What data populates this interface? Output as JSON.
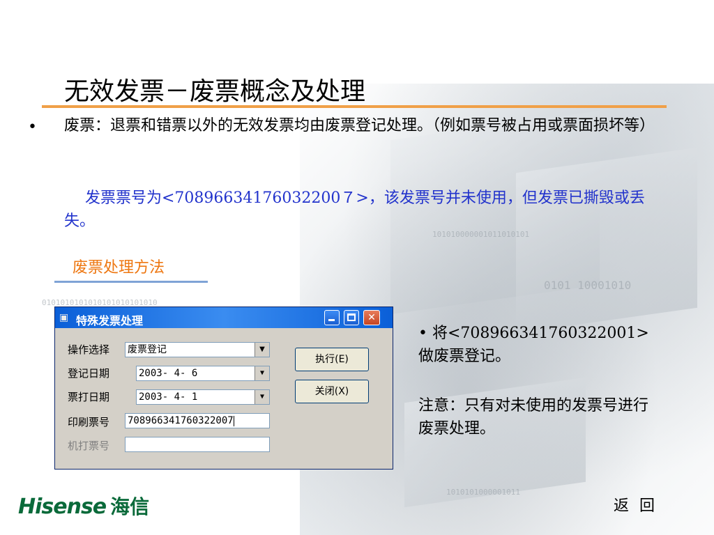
{
  "slide": {
    "title": "无效发票－废票概念及处理",
    "bullet_symbol": "•",
    "para1": "废票：退票和错票以外的无效发票均由废票登记处理。（例如票号被占用或票面损坏等）",
    "para2": "发票票号为<70896634176032200７>，该发票号并未使用，但发票已撕毁或丢失。",
    "method_label": "废票处理方法",
    "side_note1": "• 将<708966341760322001>做废票登记。",
    "side_note2": "注意：只有对未使用的发票号进行废票处理。",
    "back_link": "返 回",
    "logo_en": "Hisense",
    "logo_cn": "海信"
  },
  "dialog": {
    "title": "特殊发票处理",
    "app_icon": "printer-icon",
    "fields": {
      "operation_label": "操作选择",
      "operation_value": "废票登记",
      "register_date_label": "登记日期",
      "register_date_value": "2003- 4- 6",
      "print_date_label": "票打日期",
      "print_date_value": "2003- 4- 1",
      "printed_no_label": "印刷票号",
      "printed_no_value": "708966341760322007",
      "machine_no_label": "机打票号",
      "machine_no_value": ""
    },
    "buttons": {
      "execute": "执行(E)",
      "close": "关闭(X)"
    }
  },
  "colors": {
    "title_rule": "#f0a048",
    "method_label": "#ee7711",
    "blue_text": "#2233cc",
    "logo_green": "#0a6a3a",
    "titlebar_blue": "#0a5fd8"
  }
}
